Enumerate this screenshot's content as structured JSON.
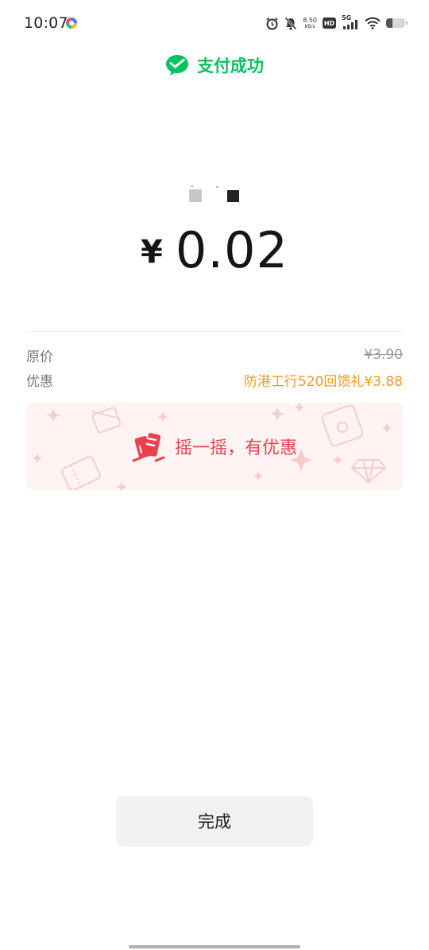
{
  "status_bar": {
    "time": "10:07",
    "net_speed_value": "8.50",
    "net_speed_unit": "KB/s",
    "hd_label": "HD",
    "signal_label": "5G",
    "battery_level": 0.35
  },
  "header": {
    "title": "支付成功",
    "accent_color": "#07c160"
  },
  "payment": {
    "currency": "¥",
    "amount": "0.02"
  },
  "details": [
    {
      "label": "原价",
      "value": "¥3.90",
      "style": "strikethrough"
    },
    {
      "label": "优惠",
      "value": "防港工行520回馈礼¥3.88",
      "style": "highlight"
    }
  ],
  "shake_banner": {
    "text": "摇一摇，有优惠",
    "text_color": "#e8424e",
    "background": "#fff4f3"
  },
  "actions": {
    "done_label": "完成"
  },
  "icons": {
    "header": "wechat-pay-icon",
    "banner": "shake-phone-icon",
    "status": [
      "alarm-icon",
      "mute-icon",
      "hd-icon",
      "signal-icon",
      "wifi-icon",
      "battery-icon"
    ]
  }
}
